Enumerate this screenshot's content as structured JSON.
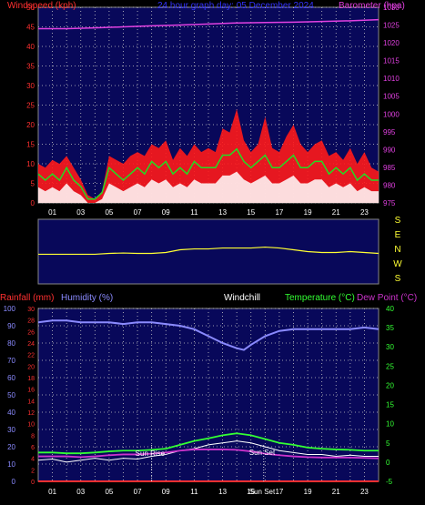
{
  "colors": {
    "background": "#000000",
    "plot_bg": "#08085a",
    "grid": "#c8c8c8",
    "wind_red": "#ff1a1a",
    "wind_white": "#ffffff",
    "wind_green": "#22dd22",
    "barometer": "#e040e0",
    "wind_dir": "#ffff33",
    "humidity": "#8a8aff",
    "rainfall": "#ff3030",
    "temperature": "#33ff33",
    "dewpoint": "#cc33cc",
    "windchill": "#ffffff",
    "axis_left_top": "#ff3030",
    "axis_right_top": "#e040e0",
    "axis_temp": "#33ff33",
    "title": "#3333ff"
  },
  "chart_data": [
    {
      "type": "line",
      "title": "24 hour graph day:  05 December 2024",
      "ylabel_left": "Windspeed (kph)",
      "ylabel_right": "Barometer (hpa)",
      "x_tick_labels": [
        "01",
        "03",
        "05",
        "07",
        "09",
        "11",
        "13",
        "15",
        "17",
        "19",
        "21",
        "23"
      ],
      "xlim_hours": [
        0,
        24
      ],
      "ylim_left": [
        0,
        50
      ],
      "yticks_left": [
        0,
        5,
        10,
        15,
        20,
        25,
        30,
        35,
        40,
        45,
        50
      ],
      "ylim_right": [
        975,
        1030
      ],
      "yticks_right": [
        975,
        980,
        985,
        990,
        995,
        1000,
        1005,
        1010,
        1015,
        1020,
        1025,
        1030
      ],
      "series": [
        {
          "name": "Wind gust",
          "hours": [
            0,
            0.5,
            1,
            1.5,
            2,
            2.5,
            3,
            3.5,
            4,
            4.5,
            5,
            5.5,
            6,
            6.5,
            7,
            7.5,
            8,
            8.5,
            9,
            9.5,
            10,
            10.5,
            11,
            11.5,
            12,
            12.5,
            13,
            13.5,
            14,
            14.5,
            15,
            15.5,
            16,
            16.5,
            17,
            17.5,
            18,
            18.5,
            19,
            19.5,
            20,
            20.5,
            21,
            21.5,
            22,
            22.5,
            23,
            23.5,
            24
          ],
          "values": [
            10,
            9,
            11,
            10,
            12,
            9,
            6,
            2,
            1,
            3,
            12,
            11,
            10,
            12,
            13,
            12,
            15,
            14,
            16,
            11,
            14,
            12,
            15,
            13,
            14,
            13,
            19,
            18,
            24,
            16,
            13,
            15,
            22,
            14,
            13,
            17,
            20,
            15,
            13,
            15,
            16,
            12,
            13,
            11,
            14,
            10,
            13,
            9,
            8
          ]
        },
        {
          "name": "Wind average",
          "hours": [
            0,
            0.5,
            1,
            1.5,
            2,
            2.5,
            3,
            3.5,
            4,
            4.5,
            5,
            5.5,
            6,
            6.5,
            7,
            7.5,
            8,
            8.5,
            9,
            9.5,
            10,
            10.5,
            11,
            11.5,
            12,
            12.5,
            13,
            13.5,
            14,
            14.5,
            15,
            15.5,
            16,
            16.5,
            17,
            17.5,
            18,
            18.5,
            19,
            19.5,
            20,
            20.5,
            21,
            21.5,
            22,
            22.5,
            23,
            23.5,
            24
          ],
          "values": [
            4,
            3,
            4,
            3,
            5,
            3,
            2,
            0,
            0,
            1,
            5,
            4,
            3,
            4,
            5,
            4,
            6,
            5,
            6,
            4,
            5,
            4,
            6,
            5,
            5,
            5,
            7,
            7,
            8,
            6,
            5,
            6,
            7,
            5,
            5,
            6,
            7,
            5,
            5,
            6,
            6,
            4,
            5,
            4,
            5,
            3,
            4,
            3,
            3
          ]
        },
        {
          "name": "Barometer",
          "hours": [
            0,
            2,
            4,
            6,
            8,
            10,
            12,
            14,
            16,
            18,
            20,
            22,
            24
          ],
          "values": [
            1024,
            1024,
            1024.2,
            1024.5,
            1024.8,
            1025,
            1025.3,
            1025.6,
            1025.7,
            1025.8,
            1026,
            1026.2,
            1026.5
          ]
        }
      ]
    },
    {
      "type": "line",
      "ylabel_right": [
        "S",
        "E",
        "N",
        "W",
        "S"
      ],
      "xlim_hours": [
        0,
        24
      ],
      "series": [
        {
          "name": "Wind direction",
          "hours": [
            0,
            1,
            2,
            3,
            4,
            5,
            6,
            7,
            8,
            9,
            10,
            11,
            12,
            13,
            14,
            15,
            16,
            17,
            18,
            19,
            20,
            21,
            22,
            23,
            24
          ],
          "values_deg": [
            165,
            165,
            165,
            165,
            165,
            170,
            172,
            170,
            170,
            175,
            190,
            195,
            195,
            200,
            200,
            200,
            205,
            200,
            190,
            180,
            175,
            175,
            180,
            175,
            170
          ]
        }
      ]
    },
    {
      "type": "line",
      "labels": {
        "rainfall": "Rainfall (mm)",
        "humidity": "Humidity (%)",
        "windchill": "Windchill",
        "temperature": "Temperature (°C)",
        "dewpoint": "Dew Point (°C)"
      },
      "annotations": {
        "sunrise": "Sun Rise",
        "sunset": "Sun Set",
        "sunset_axis": "Sun Set"
      },
      "sunrise_hour": 8.0,
      "sunset_hour": 15.9,
      "x_tick_labels": [
        "01",
        "03",
        "05",
        "07",
        "09",
        "11",
        "13",
        "15",
        "17",
        "19",
        "21",
        "23"
      ],
      "xlim_hours": [
        0,
        24
      ],
      "ylim_humidity": [
        0,
        100
      ],
      "yticks_humidity": [
        0,
        10,
        20,
        30,
        40,
        50,
        60,
        70,
        80,
        90,
        100
      ],
      "ylim_rain": [
        0,
        30
      ],
      "yticks_rain": [
        0,
        2,
        4,
        6,
        8,
        10,
        12,
        14,
        16,
        18,
        20,
        22,
        24,
        26,
        28,
        30
      ],
      "ylim_temp": [
        -5,
        40
      ],
      "yticks_temp": [
        -5,
        0,
        5,
        10,
        15,
        20,
        25,
        30,
        35,
        40
      ],
      "series": [
        {
          "name": "Humidity",
          "hours": [
            0,
            1,
            2,
            3,
            4,
            5,
            6,
            7,
            8,
            9,
            10,
            11,
            12,
            13,
            14,
            14.5,
            15,
            16,
            17,
            18,
            19,
            20,
            21,
            22,
            23,
            24
          ],
          "values": [
            92,
            93,
            93,
            92,
            92,
            92,
            91,
            92,
            92,
            91,
            90,
            88,
            84,
            80,
            77,
            76,
            79,
            84,
            87,
            88,
            88,
            88,
            88,
            88,
            89,
            88
          ]
        },
        {
          "name": "Rainfall",
          "hours": [
            0,
            24
          ],
          "values": [
            0,
            0
          ]
        },
        {
          "name": "Temperature",
          "hours": [
            0,
            1,
            2,
            3,
            4,
            5,
            6,
            7,
            8,
            9,
            10,
            11,
            12,
            13,
            14,
            15,
            16,
            17,
            18,
            19,
            20,
            21,
            22,
            23,
            24
          ],
          "values": [
            2.5,
            2.5,
            2.3,
            2.3,
            2.5,
            2.8,
            3,
            3,
            3.2,
            3.5,
            4.5,
            5.5,
            6.2,
            7,
            7.5,
            7,
            6,
            5,
            4.5,
            3.8,
            3.5,
            3.3,
            3.2,
            3,
            3
          ]
        },
        {
          "name": "Windchill",
          "hours": [
            0,
            1,
            2,
            3,
            4,
            5,
            6,
            7,
            8,
            9,
            10,
            11,
            12,
            13,
            14,
            15,
            16,
            17,
            18,
            19,
            20,
            21,
            22,
            23,
            24
          ],
          "values": [
            0.5,
            0.8,
            0,
            0.5,
            1,
            0.5,
            1,
            0.8,
            1.5,
            2,
            3,
            3.5,
            4.5,
            5,
            5.5,
            5,
            4,
            3,
            2.5,
            2,
            2,
            1.5,
            1.8,
            1.5,
            1.5
          ]
        },
        {
          "name": "Dew Point",
          "hours": [
            0,
            1,
            2,
            3,
            4,
            5,
            6,
            7,
            8,
            9,
            10,
            11,
            12,
            13,
            14,
            15,
            16,
            17,
            18,
            19,
            20,
            21,
            22,
            23,
            24
          ],
          "values": [
            1.5,
            1.5,
            1.5,
            1.3,
            1.5,
            1.8,
            2,
            2,
            2.2,
            2.5,
            3,
            3.3,
            3.3,
            3.3,
            3.2,
            2.8,
            2.2,
            1.8,
            1.5,
            1.3,
            1.2,
            1.2,
            1.2,
            1.1,
            1
          ]
        }
      ]
    }
  ]
}
